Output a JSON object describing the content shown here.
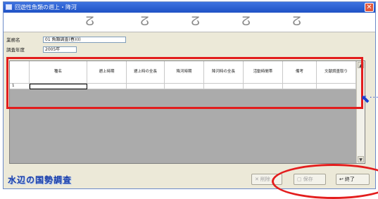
{
  "window": {
    "title": "回遊性魚類の遡上・降河",
    "close_glyph": "✕"
  },
  "binder_rings": [
    "ⵒ",
    "ⵒ",
    "ⵒ",
    "ⵒ",
    "ⵒ",
    "ⵒ"
  ],
  "info": {
    "field1_label": "業務名",
    "field1_value": "01 魚類調査(春)(I)",
    "field2_label": "調査年度",
    "field2_value": "2005年"
  },
  "grid": {
    "columns": [
      "種名",
      "遡上時期",
      "遡上時の全長",
      "降河時期",
      "降河時の全長",
      "活動時間帯",
      "備考",
      "文献調査取り"
    ],
    "rows": [
      {
        "num": "1",
        "cells": [
          "",
          "",
          "",
          "",
          "",
          "",
          "",
          ""
        ]
      }
    ],
    "scroll_up": "▲",
    "scroll_down": "▼"
  },
  "footer": {
    "brand": "水辺の国勢調査",
    "buttons": [
      {
        "icon": "✕",
        "label": "削除"
      },
      {
        "icon": "▢",
        "label": "保存"
      },
      {
        "icon": "↩",
        "label": "終了"
      }
    ]
  },
  "annotation": {
    "arrow_glyph": "⬉",
    "dots": "···"
  },
  "colors": {
    "titlebar": "#245edb",
    "highlight": "#e31d1d",
    "arrow": "#1a3fd0",
    "grid_empty": "#ababab"
  }
}
